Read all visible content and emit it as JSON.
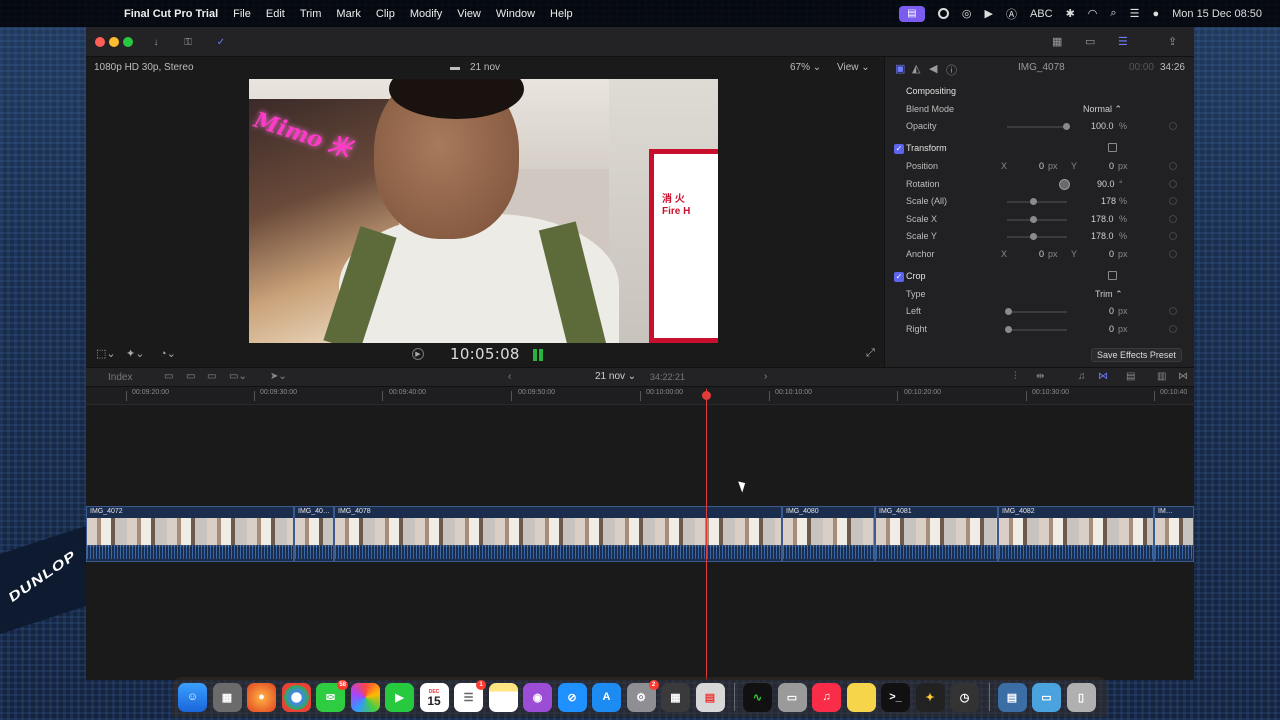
{
  "menubar": {
    "app_name": "Final Cut Pro Trial",
    "menus": [
      "File",
      "Edit",
      "Trim",
      "Mark",
      "Clip",
      "Modify",
      "View",
      "Window",
      "Help"
    ],
    "ime_label": "ABC",
    "datetime": "Mon 15 Dec  08:50"
  },
  "viewer": {
    "format": "1080p HD 30p, Stereo",
    "event_name": "21 nov",
    "zoom": "67%",
    "view_label": "View",
    "timecode": "10:05:08"
  },
  "inspector": {
    "clip_name": "IMG_4078",
    "duration_dim": "00:00",
    "duration": "34:26",
    "compositing": {
      "title": "Compositing",
      "blend_mode_label": "Blend Mode",
      "blend_mode_value": "Normal ⌃",
      "opacity_label": "Opacity",
      "opacity_value": "100.0",
      "opacity_unit": "%"
    },
    "transform": {
      "title": "Transform",
      "position_label": "Position",
      "position_x": "0",
      "position_y": "0",
      "rotation_label": "Rotation",
      "rotation_value": "90.0",
      "rotation_unit": "°",
      "scale_all_label": "Scale (All)",
      "scale_all_value": "178",
      "scale_x_label": "Scale X",
      "scale_x_value": "178.0",
      "scale_y_label": "Scale Y",
      "scale_y_value": "178.0",
      "anchor_label": "Anchor",
      "anchor_x": "0",
      "anchor_y": "0",
      "x_axis": "X",
      "y_axis": "Y",
      "px_unit": "px",
      "pct_unit": "%"
    },
    "crop": {
      "title": "Crop",
      "type_label": "Type",
      "type_value": "Trim ⌃",
      "left_label": "Left",
      "left_value": "0",
      "right_label": "Right",
      "right_value": "0"
    },
    "save_preset": "Save Effects Preset"
  },
  "timeline": {
    "index_label": "Index",
    "project_name": "21 nov",
    "project_duration": "34:22:21",
    "ruler_ticks": [
      "00:09:20:00",
      "00:09:30:00",
      "00:09:40:00",
      "00:09:50:00",
      "00:10:00:00",
      "00:10:10:00",
      "00:10:20:00",
      "00:10:30:00",
      "00:10:40"
    ],
    "clips": [
      "IMG_4072",
      "IMG_40…",
      "IMG_4078",
      "IMG_4080",
      "IMG_4081",
      "IMG_4082",
      "IM…"
    ]
  },
  "video_frame": {
    "shop_sign": "Mimo 米",
    "poster_text": "消 火\nFire H"
  },
  "dock": {
    "calendar_month": "DEC",
    "calendar_day": "15",
    "badges": {
      "messages": "58",
      "reminders": "1",
      "settings": "2"
    }
  },
  "colors": {
    "accent": "#5b63f0",
    "playhead": "#e23b3b",
    "clip_fill": "#1b2d4d"
  }
}
